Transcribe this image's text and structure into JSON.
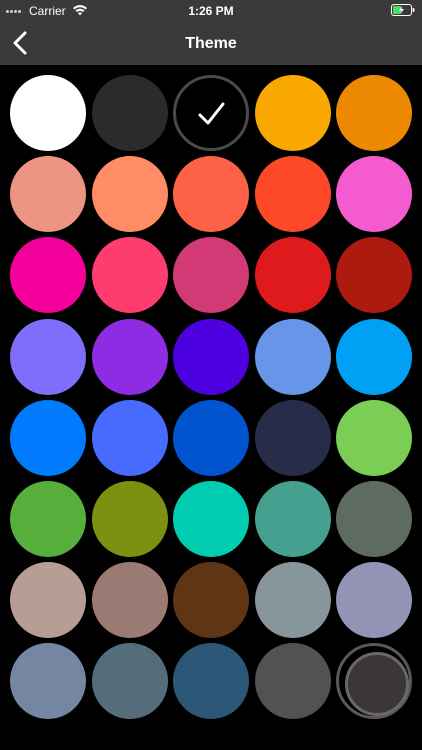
{
  "status_bar": {
    "carrier": "Carrier",
    "time": "1:26 PM",
    "signal_icon": "signal-dots-icon",
    "wifi_icon": "wifi-icon",
    "battery_icon": "battery-charging-icon"
  },
  "nav": {
    "title": "Theme",
    "back_icon": "chevron-left-icon"
  },
  "selected_index": 2,
  "colors": [
    "#ffffff",
    "#2b2b2d",
    "#000000",
    "#f8a800",
    "#ec8900",
    "#ec9583",
    "#ff8c64",
    "#fd6246",
    "#fe4929",
    "#f45bcf",
    "#f4009b",
    "#fe3c70",
    "#d13a74",
    "#df1a1c",
    "#ad1a0e",
    "#7e6ef9",
    "#8d2ce3",
    "#4d00e0",
    "#6796e8",
    "#00a1f5",
    "#007bfe",
    "#486aff",
    "#0054d0",
    "#272d49",
    "#7bcd55",
    "#57ae3a",
    "#7d9010",
    "#00cdb0",
    "#45a08f",
    "#5d6b61",
    "#b69e95",
    "#9a7a72",
    "#5e3615",
    "#87969a",
    "#9293b5",
    "#7486a2",
    "#556c7b",
    "#2d5777",
    "#505254",
    "#3b3639"
  ],
  "colors_accent": {
    "topbar": "#3a3a3c",
    "background": "#000000",
    "selected_ring": "#4a4a4c",
    "last_ring": "#5b585c"
  }
}
